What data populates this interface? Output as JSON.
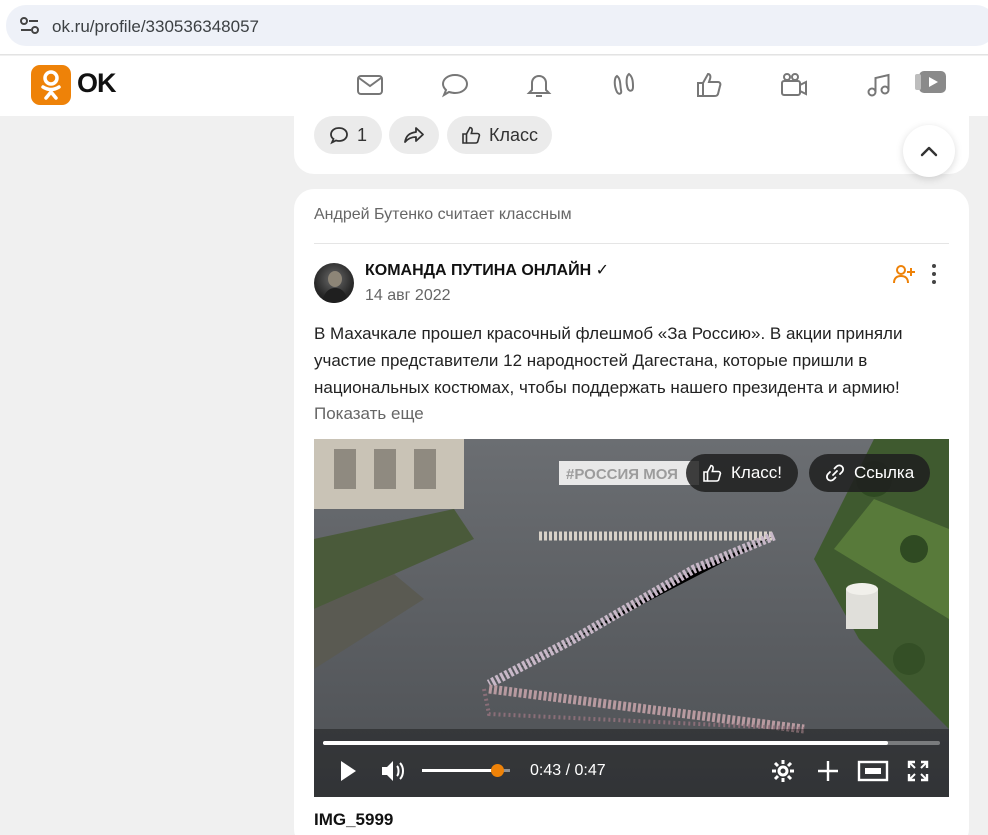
{
  "browser": {
    "url": "ok.ru/profile/330536348057",
    "icons": [
      "site-settings-icon"
    ]
  },
  "header": {
    "logo_text": "OK",
    "brand_color": "#ee8208",
    "nav_icons": [
      "messages-icon",
      "discussions-icon",
      "notifications-icon",
      "guests-icon",
      "marks-icon",
      "video-icon",
      "music-icon",
      "video-showcase-icon"
    ]
  },
  "previous_post": {
    "comments_count": "1",
    "like_label": "Класс"
  },
  "post": {
    "activity": "Андрей Бутенко считает классным",
    "author": "КОМАНДА ПУТИНА ОНЛАЙН ✓",
    "date": "14 авг 2022",
    "text": "В Махачкале прошел красочный флешмоб «За Россию». В акции приняли участие представители 12 народностей Дагестана, которые пришли в национальных костюмах, чтобы поддержать нашего президента и армию!",
    "show_more": "Показать еще",
    "video": {
      "like_label": "Класс!",
      "link_label": "Ссылка",
      "time": "0:43 / 0:47",
      "progress": 0.915,
      "volume": 0.85
    },
    "caption": "IMG_5999"
  }
}
